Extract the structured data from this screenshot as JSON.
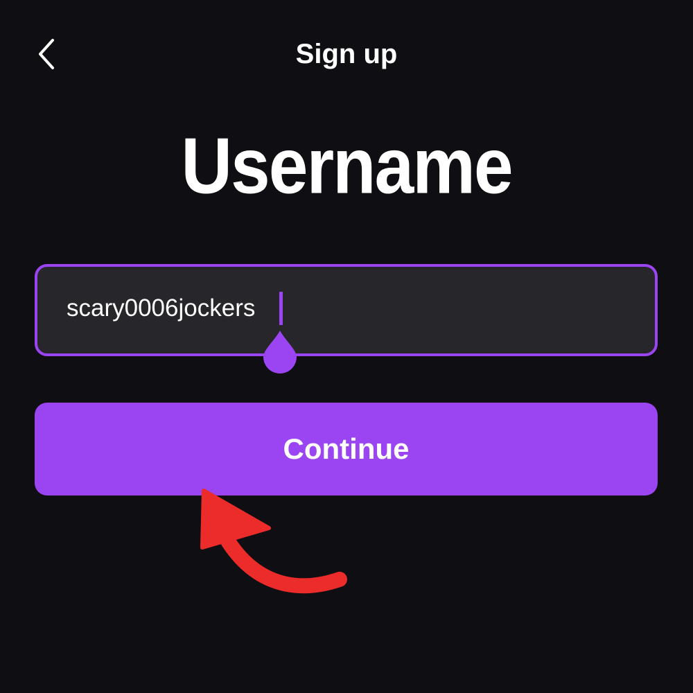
{
  "header": {
    "title": "Sign up",
    "back_icon": "chevron-left-icon"
  },
  "main": {
    "title": "Username",
    "username_input": {
      "value": "scary0006jockers",
      "placeholder": ""
    },
    "continue_label": "Continue"
  },
  "colors": {
    "background": "#0f0e12",
    "accent": "#9b45f2",
    "input_background": "#27262b",
    "annotation_arrow": "#ec2b2b",
    "text": "#ffffff"
  },
  "annotation": {
    "icon": "curved-arrow-icon"
  }
}
